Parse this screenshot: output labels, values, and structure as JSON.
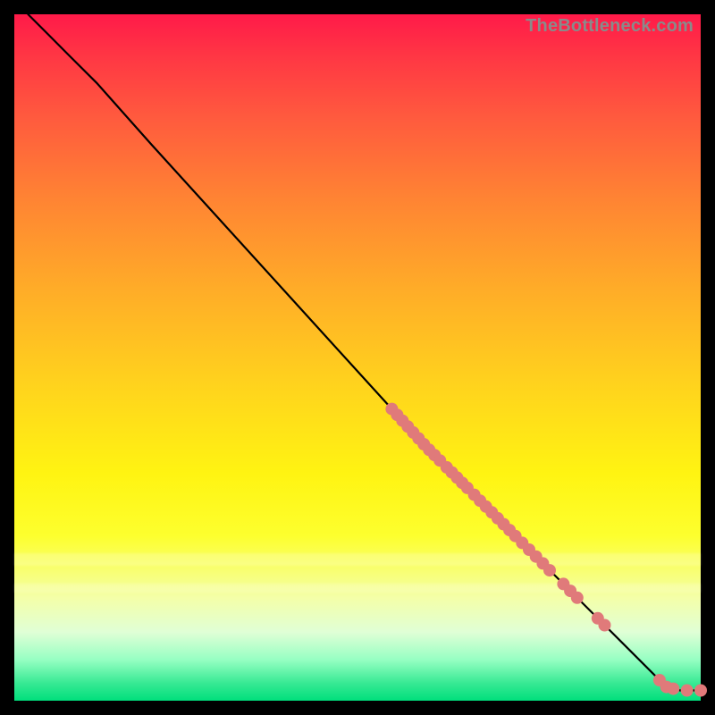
{
  "watermark": "TheBottleneck.com",
  "chart_data": {
    "type": "line",
    "title": "",
    "xlabel": "",
    "ylabel": "",
    "xlim": [
      0,
      100
    ],
    "ylim": [
      0,
      100
    ],
    "grid": false,
    "legend": false,
    "curve": [
      {
        "x": 2,
        "y": 100
      },
      {
        "x": 5,
        "y": 97
      },
      {
        "x": 8,
        "y": 94
      },
      {
        "x": 12,
        "y": 90
      },
      {
        "x": 20,
        "y": 81
      },
      {
        "x": 30,
        "y": 70
      },
      {
        "x": 40,
        "y": 59
      },
      {
        "x": 50,
        "y": 48
      },
      {
        "x": 60,
        "y": 37
      },
      {
        "x": 70,
        "y": 27
      },
      {
        "x": 80,
        "y": 17
      },
      {
        "x": 90,
        "y": 7
      },
      {
        "x": 95,
        "y": 2
      },
      {
        "x": 97,
        "y": 1.5
      },
      {
        "x": 100,
        "y": 1.5
      }
    ],
    "marker_clusters": [
      {
        "x_start": 55,
        "x_end": 62,
        "count": 10
      },
      {
        "x_start": 63,
        "x_end": 66,
        "count": 5
      },
      {
        "x_start": 67,
        "x_end": 73,
        "count": 8
      },
      {
        "x_start": 74,
        "x_end": 78,
        "count": 5
      },
      {
        "x_start": 80,
        "x_end": 82,
        "count": 3
      },
      {
        "x_start": 85,
        "x_end": 86,
        "count": 2
      },
      {
        "x_start": 94,
        "x_end": 96,
        "count": 3
      },
      {
        "x_start": 98,
        "x_end": 100,
        "count": 2
      }
    ],
    "marker_radius_approx": 7,
    "background_gradient_stops": [
      {
        "pos": 0,
        "color": "#ff1a49"
      },
      {
        "pos": 0.5,
        "color": "#ffd31d"
      },
      {
        "pos": 0.8,
        "color": "#fdff2e"
      },
      {
        "pos": 1.0,
        "color": "#00df7c"
      }
    ]
  }
}
